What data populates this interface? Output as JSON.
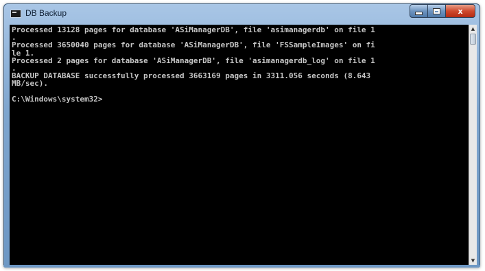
{
  "window": {
    "title": "DB Backup",
    "icon": "console-icon",
    "controls": {
      "minimize_icon": "minimize-icon",
      "maximize_icon": "maximize-icon",
      "close_label": "x"
    }
  },
  "console": {
    "lines": [
      "Processed 13128 pages for database 'ASiManagerDB', file 'asimanagerdb' on file 1",
      ".",
      "Processed 3650040 pages for database 'ASiManagerDB', file 'FSSampleImages' on fi",
      "le 1.",
      "Processed 2 pages for database 'ASiManagerDB', file 'asimanagerdb_log' on file 1",
      ".",
      "BACKUP DATABASE successfully processed 3663169 pages in 3311.056 seconds (8.643",
      "MB/sec).",
      "",
      "C:\\Windows\\system32>"
    ],
    "background": "#000000",
    "foreground": "#c6c6c6"
  },
  "scrollbar": {
    "up_icon": "scroll-up-arrow-icon",
    "down_icon": "scroll-down-arrow-icon"
  },
  "colors": {
    "frame": "#7fa6cf",
    "close_button": "#cf4a2e"
  }
}
